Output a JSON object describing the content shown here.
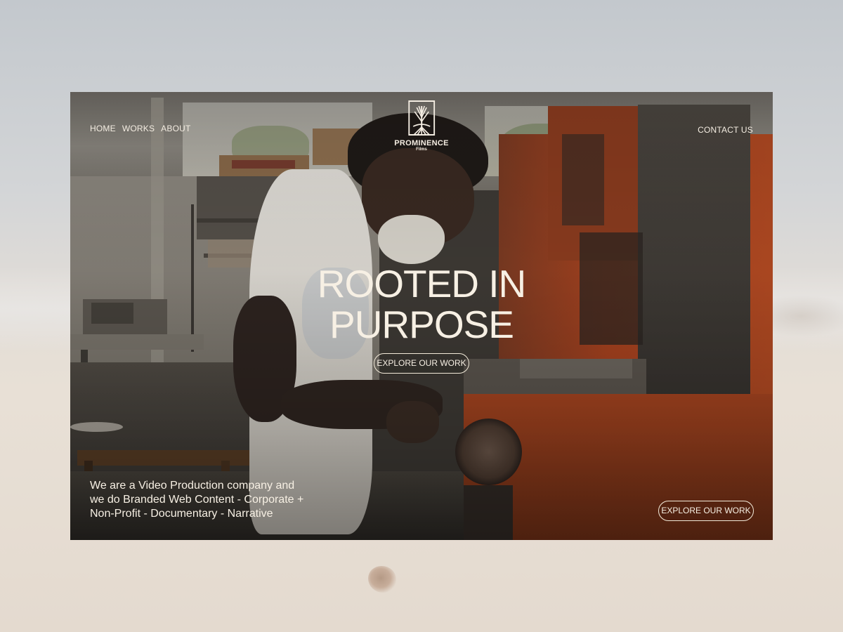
{
  "nav": {
    "links": [
      "HOME",
      "WORKS",
      "ABOUT"
    ],
    "contact": "CONTACT US"
  },
  "logo": {
    "name": "PROMINENCE",
    "sub": "Films",
    "icon": "tree-icon"
  },
  "hero": {
    "headline_line1": "ROOTED IN",
    "headline_line2": "PURPOSE",
    "cta_center": "EXPLORE OUR WORK",
    "cta_corner": "EXPLORE OUR WORK",
    "tagline_lines": [
      "We are a Video Production company and",
      "we do Branded Web Content - Corporate +",
      "Non-Profit - Documentary  - Narrative"
    ]
  },
  "colors": {
    "text": "#f4ede2",
    "machine_orange": "#a8421f",
    "backdrop": "#e2ddd7"
  }
}
